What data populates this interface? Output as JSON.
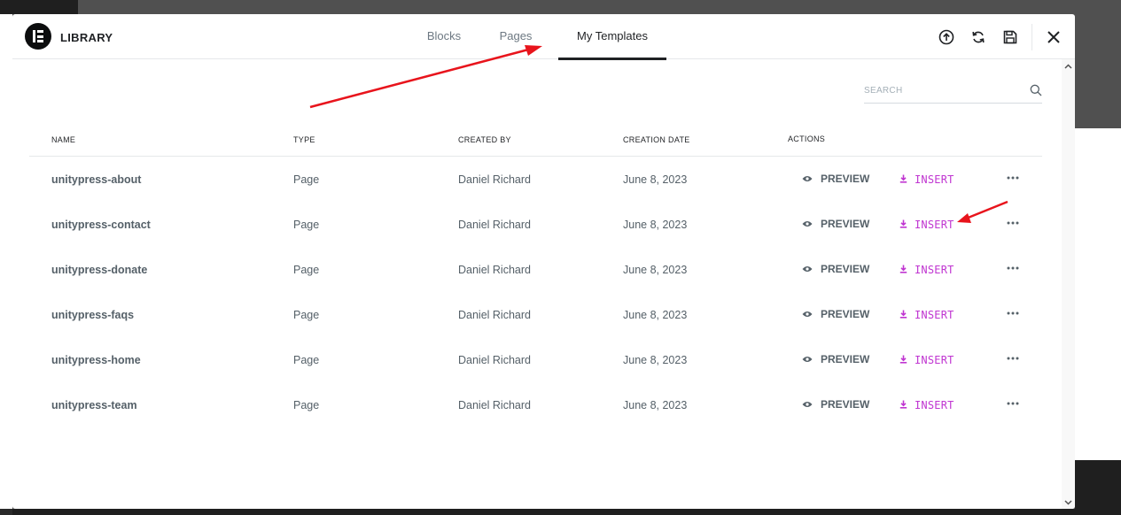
{
  "header": {
    "title": "LIBRARY",
    "tabs": [
      {
        "label": "Blocks",
        "active": false
      },
      {
        "label": "Pages",
        "active": false
      },
      {
        "label": "My Templates",
        "active": true
      }
    ],
    "icons": [
      "upload-icon",
      "sync-icon",
      "save-icon",
      "close-icon"
    ]
  },
  "search": {
    "placeholder": "SEARCH",
    "value": ""
  },
  "table": {
    "columns": {
      "name": "NAME",
      "type": "TYPE",
      "created_by": "CREATED BY",
      "creation_date": "CREATION DATE",
      "actions": "ACTIONS"
    },
    "rows": [
      {
        "name": "unitypress-about",
        "type": "Page",
        "created_by": "Daniel Richard",
        "date": "June 8, 2023"
      },
      {
        "name": "unitypress-contact",
        "type": "Page",
        "created_by": "Daniel Richard",
        "date": "June 8, 2023"
      },
      {
        "name": "unitypress-donate",
        "type": "Page",
        "created_by": "Daniel Richard",
        "date": "June 8, 2023"
      },
      {
        "name": "unitypress-faqs",
        "type": "Page",
        "created_by": "Daniel Richard",
        "date": "June 8, 2023"
      },
      {
        "name": "unitypress-home",
        "type": "Page",
        "created_by": "Daniel Richard",
        "date": "June 8, 2023"
      },
      {
        "name": "unitypress-team",
        "type": "Page",
        "created_by": "Daniel Richard",
        "date": "June 8, 2023"
      }
    ],
    "preview_label": "PREVIEW",
    "insert_label": "INSERT"
  },
  "colors": {
    "accent": "#c036d1",
    "text": "#556068",
    "annotation": "#e8141c"
  }
}
